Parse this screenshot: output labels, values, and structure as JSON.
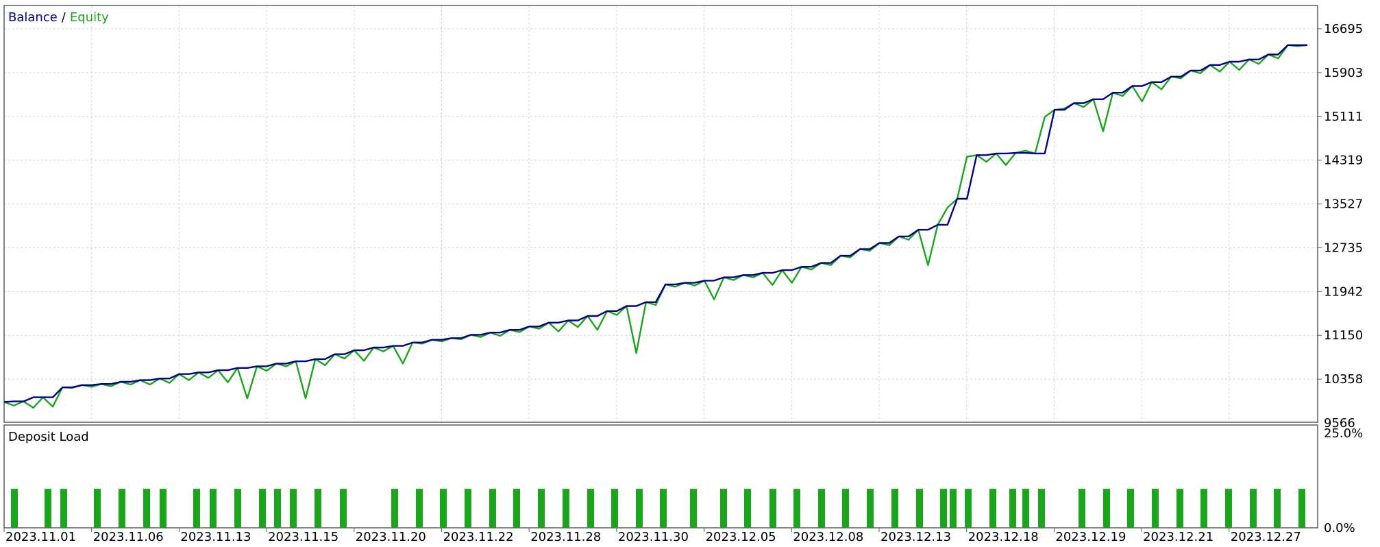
{
  "legend": {
    "balance_label": "Balance",
    "separator": "/",
    "equity_label": "Equity"
  },
  "deposit_panel": {
    "title": "Deposit Load"
  },
  "colors": {
    "balance": "#00008b",
    "equity": "#1aa51a",
    "deposit": "#1aa51a",
    "grid": "#d4d4d4",
    "frame": "#5a5a5a"
  },
  "chart_data": [
    {
      "type": "line",
      "yticks": [
        "16695",
        "15903",
        "15111",
        "14319",
        "13527",
        "12735",
        "11942",
        "11150",
        "10358",
        "9566"
      ],
      "ylim": [
        9566,
        17200
      ],
      "xticks": [
        "2023.11.01",
        "2023.11.06",
        "2023.11.13",
        "2023.11.15",
        "2023.11.20",
        "2023.11.22",
        "2023.11.28",
        "2023.11.30",
        "2023.12.05",
        "2023.12.08",
        "2023.12.13",
        "2023.12.18",
        "2023.12.19",
        "2023.12.21",
        "2023.12.27"
      ],
      "grid": true,
      "legend": "top-left",
      "series": [
        {
          "name": "Balance",
          "values": [
            9945,
            9955,
            9955,
            10030,
            10030,
            10030,
            10210,
            10210,
            10250,
            10250,
            10270,
            10270,
            10310,
            10310,
            10340,
            10340,
            10370,
            10370,
            10450,
            10450,
            10480,
            10480,
            10520,
            10520,
            10560,
            10560,
            10590,
            10590,
            10640,
            10640,
            10680,
            10680,
            10720,
            10720,
            10810,
            10810,
            10880,
            10880,
            10930,
            10930,
            10960,
            10960,
            11020,
            11020,
            11070,
            11070,
            11100,
            11100,
            11160,
            11160,
            11200,
            11200,
            11250,
            11250,
            11310,
            11310,
            11380,
            11380,
            11420,
            11420,
            11500,
            11500,
            11590,
            11590,
            11680,
            11680,
            11750,
            11750,
            12070,
            12070,
            12100,
            12100,
            12140,
            12140,
            12200,
            12200,
            12240,
            12240,
            12280,
            12280,
            12330,
            12330,
            12390,
            12390,
            12460,
            12460,
            12590,
            12590,
            12710,
            12710,
            12820,
            12820,
            12940,
            12940,
            13060,
            13060,
            13150,
            13150,
            13620,
            13620,
            14410,
            14410,
            14440,
            14440,
            14450,
            14450,
            14440,
            14440,
            15230,
            15230,
            15350,
            15350,
            15420,
            15420,
            15540,
            15540,
            15660,
            15660,
            15730,
            15730,
            15830,
            15830,
            15940,
            15940,
            16040,
            16040,
            16100,
            16100,
            16140,
            16140,
            16230,
            16230,
            16400,
            16400,
            16400
          ]
        },
        {
          "name": "Equity",
          "values": [
            9945,
            9880,
            9955,
            9840,
            10030,
            9860,
            10210,
            10200,
            10250,
            10220,
            10270,
            10230,
            10310,
            10260,
            10340,
            10260,
            10370,
            10290,
            10450,
            10340,
            10480,
            10380,
            10520,
            10300,
            10560,
            10010,
            10590,
            10510,
            10640,
            10590,
            10680,
            10010,
            10720,
            10610,
            10810,
            10730,
            10880,
            10690,
            10930,
            10860,
            10960,
            10640,
            11020,
            11000,
            11070,
            11040,
            11100,
            11080,
            11160,
            11120,
            11200,
            11140,
            11250,
            11210,
            11310,
            11270,
            11380,
            11220,
            11420,
            11300,
            11500,
            11250,
            11590,
            11520,
            11680,
            10830,
            11750,
            11700,
            12070,
            12030,
            12100,
            12050,
            12140,
            11800,
            12200,
            12150,
            12240,
            12200,
            12280,
            12060,
            12330,
            12100,
            12390,
            12340,
            12460,
            12420,
            12590,
            12560,
            12710,
            12680,
            12820,
            12780,
            12940,
            12880,
            13060,
            12420,
            13150,
            13460,
            13620,
            14380,
            14410,
            14290,
            14440,
            14230,
            14450,
            14490,
            14440,
            15100,
            15230,
            15250,
            15350,
            15280,
            15420,
            14840,
            15540,
            15480,
            15660,
            15380,
            15730,
            15600,
            15830,
            15800,
            15940,
            15890,
            16040,
            15920,
            16100,
            15950,
            16140,
            16060,
            16230,
            16160,
            16400,
            16380,
            16400
          ]
        }
      ]
    },
    {
      "type": "bar",
      "title": "Deposit Load",
      "yticks": [
        "25.0%",
        "0.0%"
      ],
      "ylim": [
        0,
        25
      ],
      "values": [
        10.3,
        10.3,
        10.3,
        10.3,
        10.3,
        10.3,
        10.3,
        10.3,
        10.3,
        10.3,
        10.3,
        10.3,
        10.3,
        10.3,
        10.3,
        10.3,
        10.3,
        10.3,
        10.3,
        10.3,
        10.3,
        10.3,
        10.3,
        10.3,
        10.3,
        10.3,
        10.3,
        10.3,
        10.3,
        10.3,
        10.3,
        10.3,
        10.3,
        10.3,
        10.3,
        10.3,
        10.3,
        10.3,
        10.3,
        10.3,
        10.3,
        10.3,
        10.3,
        10.3,
        10.3,
        10.3,
        10.3,
        10.3,
        10.3,
        10.3,
        10.3,
        10.3,
        10.3,
        10.3,
        10.3,
        10.3
      ]
    }
  ]
}
